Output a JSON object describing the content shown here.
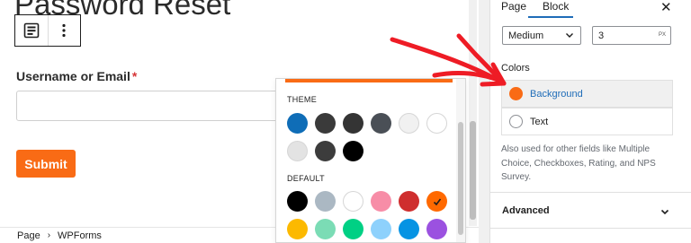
{
  "editor": {
    "page_title": "Password Reset",
    "field_label": "Username or Email",
    "required_mark": "*",
    "submit_label": "Submit"
  },
  "breadcrumb": {
    "items": [
      "Page",
      "WPForms"
    ],
    "separator": "›"
  },
  "popover": {
    "theme_heading": "THEME",
    "default_heading": "DEFAULT",
    "theme_colors": [
      "#0f6db7",
      "#3a3a3a",
      "#343434",
      "#4a4f56",
      "#f1f1f1",
      "#ffffff",
      "#e3e3e3",
      "#3c3c3c",
      "#000000"
    ],
    "default_colors": [
      "#000000",
      "#abb8c3",
      "#ffffff",
      "#f78da7",
      "#cf2e2e",
      "#ff6900",
      "#fcb900",
      "#7bdcb5",
      "#00d084",
      "#8ed1fc",
      "#0693e3",
      "#9b51e0"
    ],
    "selected_default_index": 5
  },
  "sidebar": {
    "tabs": [
      "Page",
      "Block"
    ],
    "active_tab": "Block",
    "close_icon": "close-icon",
    "size_select_value": "Medium",
    "number_value": "3",
    "number_unit": "PX",
    "colors_label": "Colors",
    "color_rows": [
      {
        "label": "Background",
        "color": "#f96b15",
        "selected": true
      },
      {
        "label": "Text",
        "color": "#ffffff",
        "selected": false
      }
    ],
    "help_text": "Also used for other fields like Multiple Choice, Checkboxes, Rating, and NPS Survey.",
    "advanced_label": "Advanced"
  },
  "colors": {
    "accent": "#f96b15",
    "link": "#1e6cb8",
    "annotation": "#ee1c25"
  }
}
